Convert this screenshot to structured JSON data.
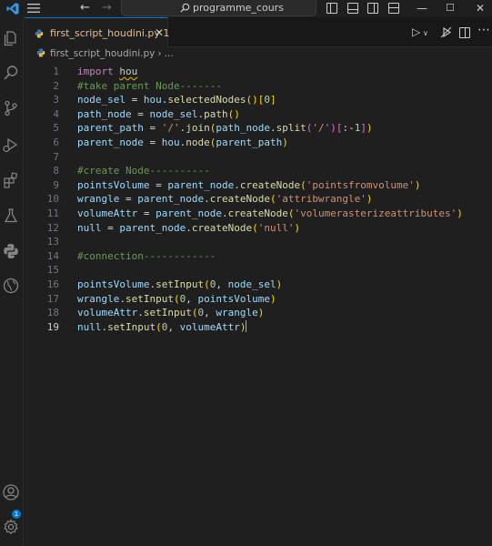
{
  "titlebar": {
    "search_text": "programme_cours",
    "back_icon": "arrow-left-icon",
    "forward_icon": "arrow-right-icon"
  },
  "tab": {
    "label": "first_script_houdini.py",
    "problems": "1",
    "label_color": "#e2c08d"
  },
  "breadcrumbs": {
    "file": "first_script_houdini.py",
    "rest": "..."
  },
  "accounts_badge": "1",
  "accent_color": "#0078d4",
  "editor": {
    "lines": [
      {
        "n": "1",
        "tokens": [
          [
            "kw",
            "import"
          ],
          [
            "tx",
            " "
          ],
          [
            "squig",
            "hou"
          ]
        ]
      },
      {
        "n": "2",
        "tokens": [
          [
            "cm",
            "#take parent Node-------"
          ]
        ]
      },
      {
        "n": "3",
        "tokens": [
          [
            "vr",
            "node_sel"
          ],
          [
            "tx",
            " = "
          ],
          [
            "vr",
            "hou"
          ],
          [
            "tx",
            "."
          ],
          [
            "fn",
            "selectedNodes"
          ],
          [
            "p1",
            "()"
          ],
          [
            "p1",
            "["
          ],
          [
            "nm",
            "0"
          ],
          [
            "p1",
            "]"
          ]
        ]
      },
      {
        "n": "4",
        "tokens": [
          [
            "vr",
            "path_node"
          ],
          [
            "tx",
            " = "
          ],
          [
            "vr",
            "node_sel"
          ],
          [
            "tx",
            "."
          ],
          [
            "fn",
            "path"
          ],
          [
            "p1",
            "()"
          ]
        ]
      },
      {
        "n": "5",
        "tokens": [
          [
            "vr",
            "parent_path"
          ],
          [
            "tx",
            " = "
          ],
          [
            "st",
            "'/'"
          ],
          [
            "tx",
            "."
          ],
          [
            "fn",
            "join"
          ],
          [
            "p1",
            "("
          ],
          [
            "vr",
            "path_node"
          ],
          [
            "tx",
            "."
          ],
          [
            "fn",
            "split"
          ],
          [
            "p2",
            "("
          ],
          [
            "st",
            "'/'"
          ],
          [
            "p2",
            ")"
          ],
          [
            "p2",
            "["
          ],
          [
            "tx",
            ":-"
          ],
          [
            "nm",
            "1"
          ],
          [
            "p2",
            "]"
          ],
          [
            "p1",
            ")"
          ]
        ]
      },
      {
        "n": "6",
        "tokens": [
          [
            "vr",
            "parent_node"
          ],
          [
            "tx",
            " = "
          ],
          [
            "vr",
            "hou"
          ],
          [
            "tx",
            "."
          ],
          [
            "fn",
            "node"
          ],
          [
            "p1",
            "("
          ],
          [
            "vr",
            "parent_path"
          ],
          [
            "p1",
            ")"
          ]
        ]
      },
      {
        "n": "7",
        "tokens": []
      },
      {
        "n": "8",
        "tokens": [
          [
            "cm",
            "#create Node----------"
          ]
        ]
      },
      {
        "n": "9",
        "tokens": [
          [
            "vr",
            "pointsVolume"
          ],
          [
            "tx",
            " = "
          ],
          [
            "vr",
            "parent_node"
          ],
          [
            "tx",
            "."
          ],
          [
            "fn",
            "createNode"
          ],
          [
            "p1",
            "("
          ],
          [
            "st",
            "'pointsfromvolume'"
          ],
          [
            "p1",
            ")"
          ]
        ]
      },
      {
        "n": "10",
        "tokens": [
          [
            "vr",
            "wrangle"
          ],
          [
            "tx",
            " = "
          ],
          [
            "vr",
            "parent_node"
          ],
          [
            "tx",
            "."
          ],
          [
            "fn",
            "createNode"
          ],
          [
            "p1",
            "("
          ],
          [
            "st",
            "'attribwrangle'"
          ],
          [
            "p1",
            ")"
          ]
        ]
      },
      {
        "n": "11",
        "tokens": [
          [
            "vr",
            "volumeAttr"
          ],
          [
            "tx",
            " = "
          ],
          [
            "vr",
            "parent_node"
          ],
          [
            "tx",
            "."
          ],
          [
            "fn",
            "createNode"
          ],
          [
            "p1",
            "("
          ],
          [
            "st",
            "'volumerasterizeattributes'"
          ],
          [
            "p1",
            ")"
          ]
        ]
      },
      {
        "n": "12",
        "tokens": [
          [
            "vr",
            "null"
          ],
          [
            "tx",
            " = "
          ],
          [
            "vr",
            "parent_node"
          ],
          [
            "tx",
            "."
          ],
          [
            "fn",
            "createNode"
          ],
          [
            "p1",
            "("
          ],
          [
            "st",
            "'null'"
          ],
          [
            "p1",
            ")"
          ]
        ]
      },
      {
        "n": "13",
        "tokens": []
      },
      {
        "n": "14",
        "tokens": [
          [
            "cm",
            "#connection------------"
          ]
        ]
      },
      {
        "n": "15",
        "tokens": []
      },
      {
        "n": "16",
        "tokens": [
          [
            "vr",
            "pointsVolume"
          ],
          [
            "tx",
            "."
          ],
          [
            "fn",
            "setInput"
          ],
          [
            "p1",
            "("
          ],
          [
            "nm",
            "0"
          ],
          [
            "tx",
            ", "
          ],
          [
            "vr",
            "node_sel"
          ],
          [
            "p1",
            ")"
          ]
        ]
      },
      {
        "n": "17",
        "tokens": [
          [
            "vr",
            "wrangle"
          ],
          [
            "tx",
            "."
          ],
          [
            "fn",
            "setInput"
          ],
          [
            "p1",
            "("
          ],
          [
            "nm",
            "0"
          ],
          [
            "tx",
            ", "
          ],
          [
            "vr",
            "pointsVolume"
          ],
          [
            "p1",
            ")"
          ]
        ]
      },
      {
        "n": "18",
        "tokens": [
          [
            "vr",
            "volumeAttr"
          ],
          [
            "tx",
            "."
          ],
          [
            "fn",
            "setInput"
          ],
          [
            "p1",
            "("
          ],
          [
            "nm",
            "0"
          ],
          [
            "tx",
            ", "
          ],
          [
            "vr",
            "wrangle"
          ],
          [
            "p1",
            ")"
          ]
        ]
      },
      {
        "n": "19",
        "tokens": [
          [
            "vr",
            "null"
          ],
          [
            "tx",
            "."
          ],
          [
            "fn",
            "setInput"
          ],
          [
            "p1",
            "("
          ],
          [
            "nm",
            "0"
          ],
          [
            "tx",
            ", "
          ],
          [
            "vr",
            "volumeAttr"
          ],
          [
            "p1",
            ")"
          ],
          [
            "caret",
            ""
          ]
        ]
      }
    ],
    "current_line": "19"
  }
}
